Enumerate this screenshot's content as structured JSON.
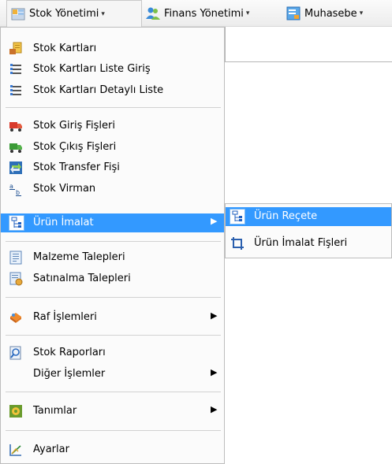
{
  "menubar": {
    "items": [
      {
        "label": "Stok Yönetimi",
        "icon": "stock-management-icon",
        "caret": "▾"
      },
      {
        "label": "Finans Yönetimi",
        "icon": "finance-icon",
        "caret": "▾"
      },
      {
        "label": "Muhasebe",
        "icon": "accounting-icon",
        "caret": "▾"
      }
    ]
  },
  "dropdown": {
    "items": [
      {
        "label": "Stok Kartları",
        "icon": "stock-cards-icon"
      },
      {
        "label": "Stok Kartları Liste Giriş",
        "icon": "list-icon"
      },
      {
        "label": "Stok Kartları Detaylı Liste",
        "icon": "list-icon"
      },
      {
        "label": "Stok Giriş Fişleri",
        "icon": "stock-in-truck-icon"
      },
      {
        "label": "Stok Çıkış Fişleri",
        "icon": "stock-out-truck-icon"
      },
      {
        "label": "Stok Transfer Fişi",
        "icon": "transfer-icon"
      },
      {
        "label": "Stok Virman",
        "icon": "virman-icon"
      },
      {
        "label": "Ürün İmalat",
        "icon": "tree-icon",
        "arrow": "▶"
      },
      {
        "label": "Malzeme Talepleri",
        "icon": "request-icon"
      },
      {
        "label": "Satınalma Talepleri",
        "icon": "purchase-icon"
      },
      {
        "label": "Raf İşlemleri",
        "icon": "shelf-icon",
        "arrow": "▶"
      },
      {
        "label": "Stok Raporları",
        "icon": "report-icon"
      },
      {
        "label": "Diğer İşlemler",
        "icon": "",
        "arrow": "▶"
      },
      {
        "label": "Tanımlar",
        "icon": "definitions-icon",
        "arrow": "▶"
      },
      {
        "label": "Ayarlar",
        "icon": "settings-icon"
      }
    ]
  },
  "submenu": {
    "items": [
      {
        "label": "Ürün Reçete",
        "icon": "tree-icon"
      },
      {
        "label": "Ürün İmalat Fişleri",
        "icon": "crop-icon"
      }
    ]
  },
  "colors": {
    "highlight": "#3399ff",
    "menu_bg": "#fbfbfb"
  }
}
